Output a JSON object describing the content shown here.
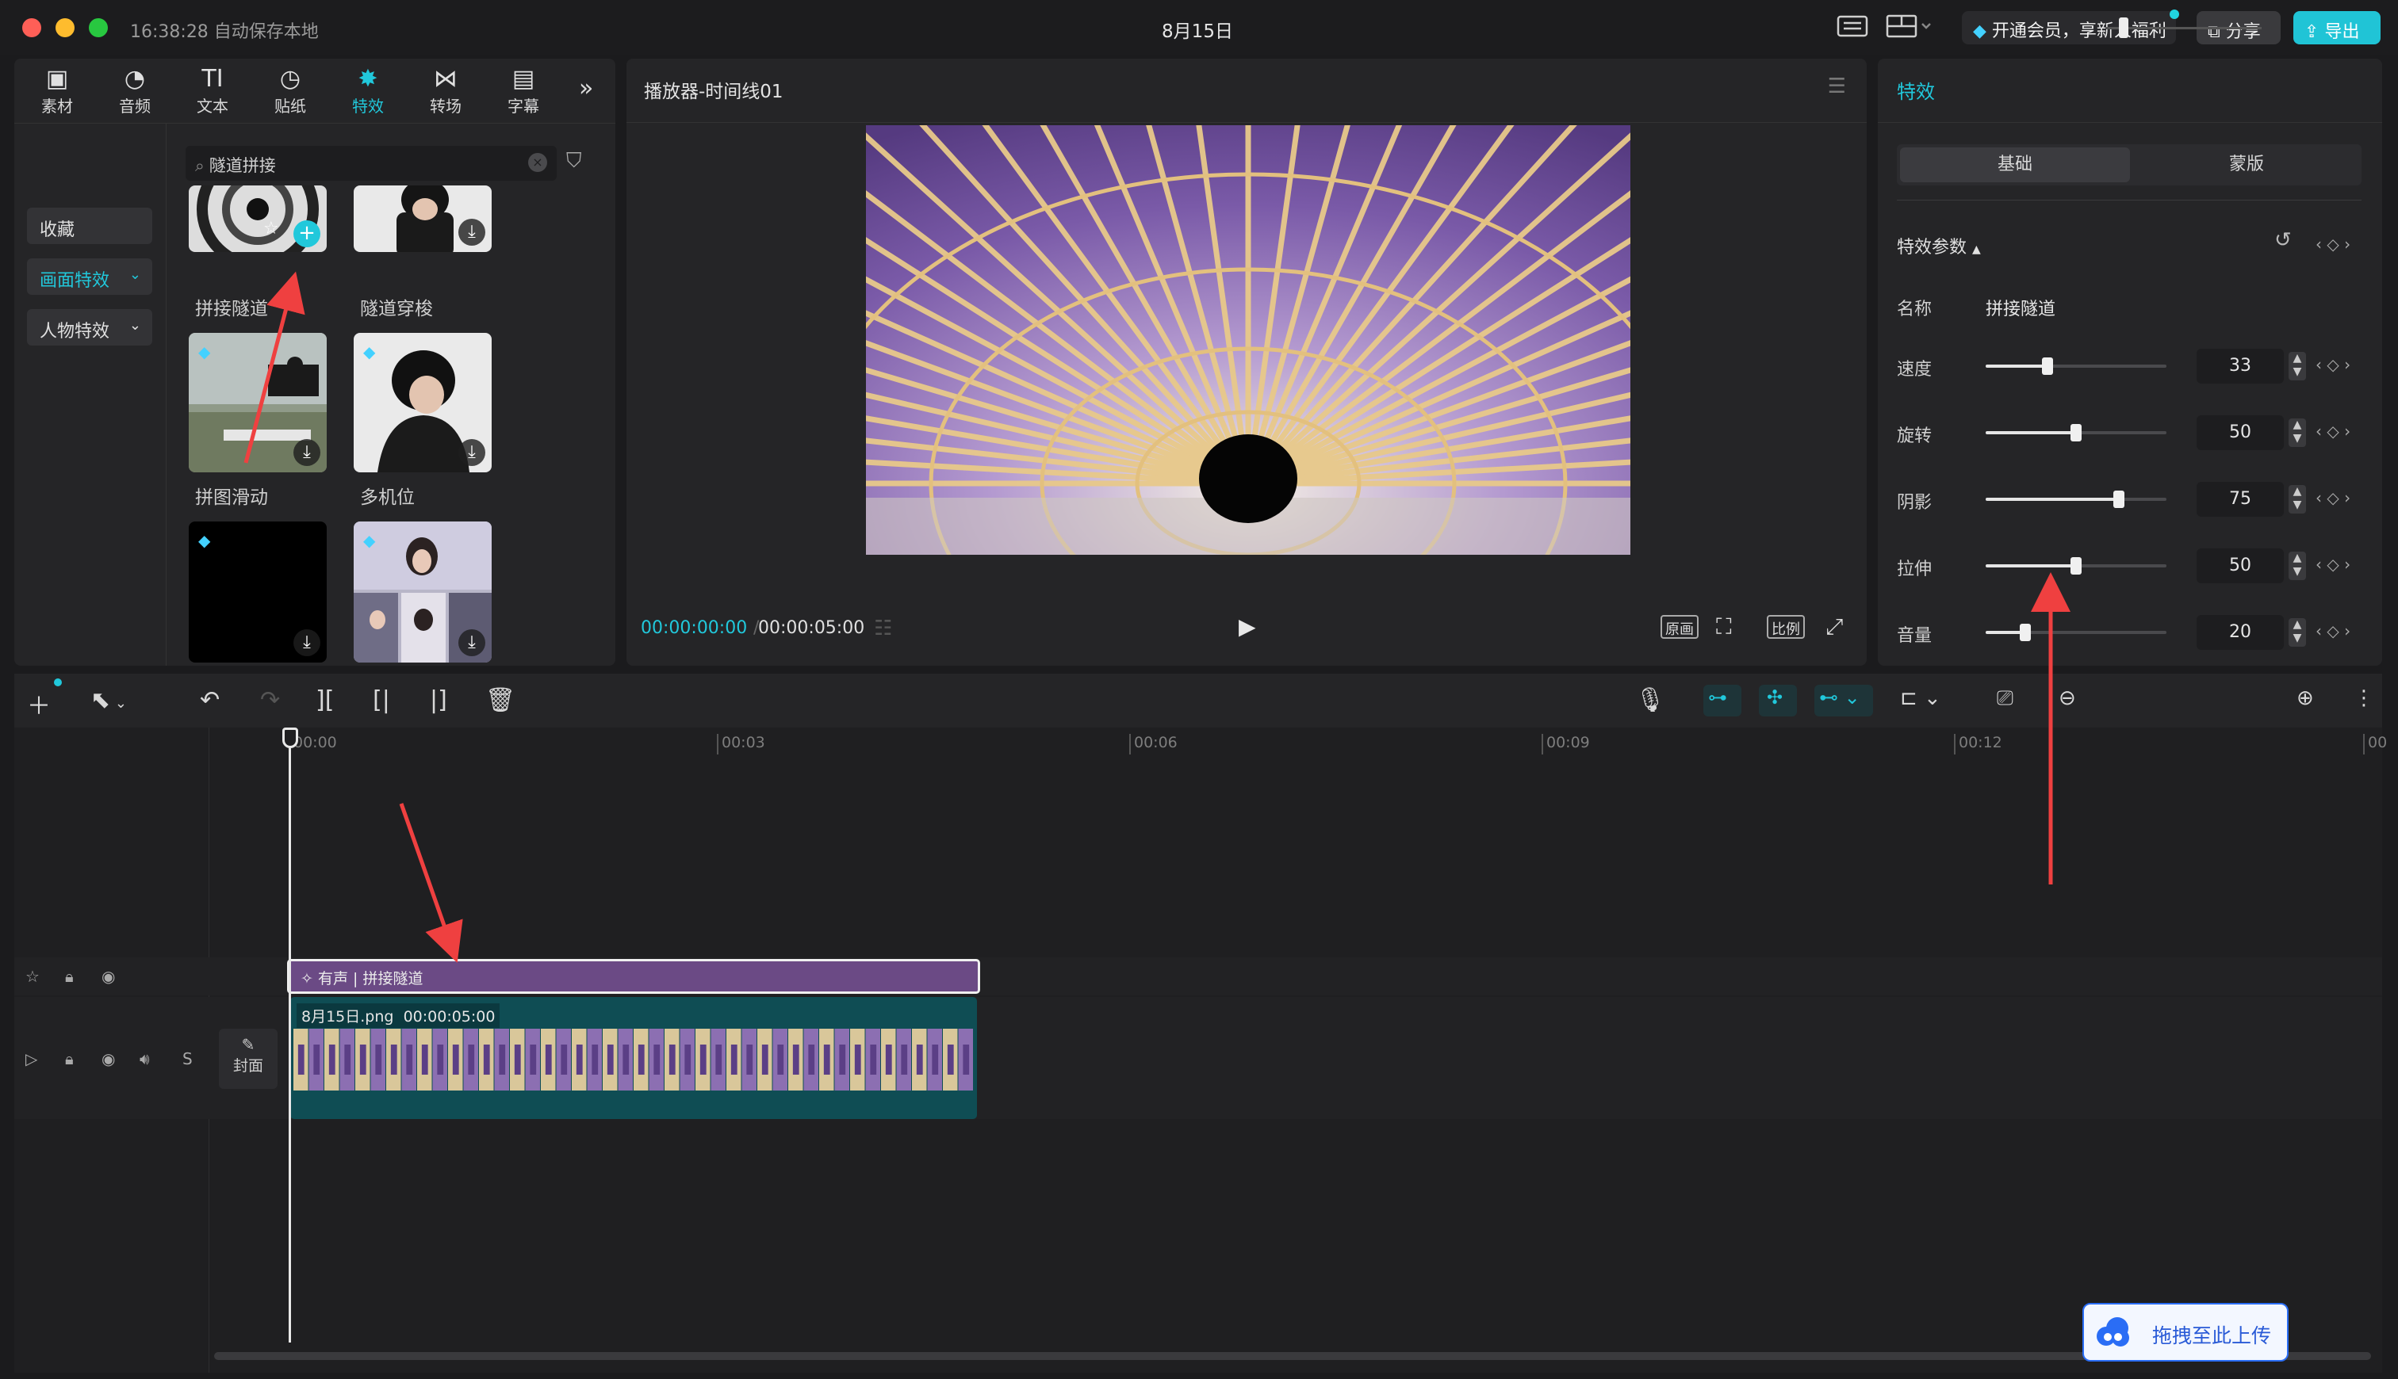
{
  "titlebar": {
    "autosave": "16:38:28 自动保存本地",
    "title": "8月15日",
    "vip": "开通会员，享新人福利",
    "share": "分享",
    "export": "导出"
  },
  "left_panel": {
    "tabs": [
      {
        "label": "素材",
        "icon": "media-icon"
      },
      {
        "label": "音频",
        "icon": "audio-icon"
      },
      {
        "label": "文本",
        "icon": "text-icon"
      },
      {
        "label": "贴纸",
        "icon": "sticker-icon"
      },
      {
        "label": "特效",
        "icon": "effects-icon",
        "active": true
      },
      {
        "label": "转场",
        "icon": "transition-icon"
      },
      {
        "label": "字幕",
        "icon": "subtitle-icon"
      }
    ],
    "subnav": [
      {
        "label": "收藏"
      },
      {
        "label": "画面特效",
        "active": true
      },
      {
        "label": "人物特效"
      }
    ],
    "search": {
      "value": "隧道拼接"
    },
    "effects": [
      {
        "label": "拼接隧道"
      },
      {
        "label": "隧道穿梭"
      },
      {
        "label": "拼图滑动"
      },
      {
        "label": "多机位"
      },
      {
        "label": ""
      },
      {
        "label": ""
      }
    ]
  },
  "player": {
    "title": "播放器-时间线01",
    "time_current": "00:00:00:00",
    "time_total": "00:00:05:00",
    "controls": {
      "original": "原画",
      "ratio": "比例"
    }
  },
  "right_panel": {
    "title": "特效",
    "tabs": {
      "basic": "基础",
      "mask": "蒙版"
    },
    "params_title": "特效参数",
    "name_label": "名称",
    "name_value": "拼接隧道",
    "params": [
      {
        "label": "速度",
        "value": "33"
      },
      {
        "label": "旋转",
        "value": "50"
      },
      {
        "label": "阴影",
        "value": "75"
      },
      {
        "label": "拉伸",
        "value": "50"
      },
      {
        "label": "音量",
        "value": "20"
      }
    ]
  },
  "timeline": {
    "ruler": [
      "00:00",
      "00:03",
      "00:06",
      "00:09",
      "00:12",
      "00"
    ],
    "fx_clip": "有声 | 拼接隧道",
    "video_clip": {
      "name": "8月15日.png",
      "duration": "00:00:05:00"
    },
    "cover": "封面",
    "solo": "S",
    "upload": "拖拽至此上传"
  },
  "colors": {
    "accent": "#21c8db",
    "fx_clip": "#6b4a85",
    "video_clip": "#0f4d54",
    "arrow": "#ef4040"
  }
}
